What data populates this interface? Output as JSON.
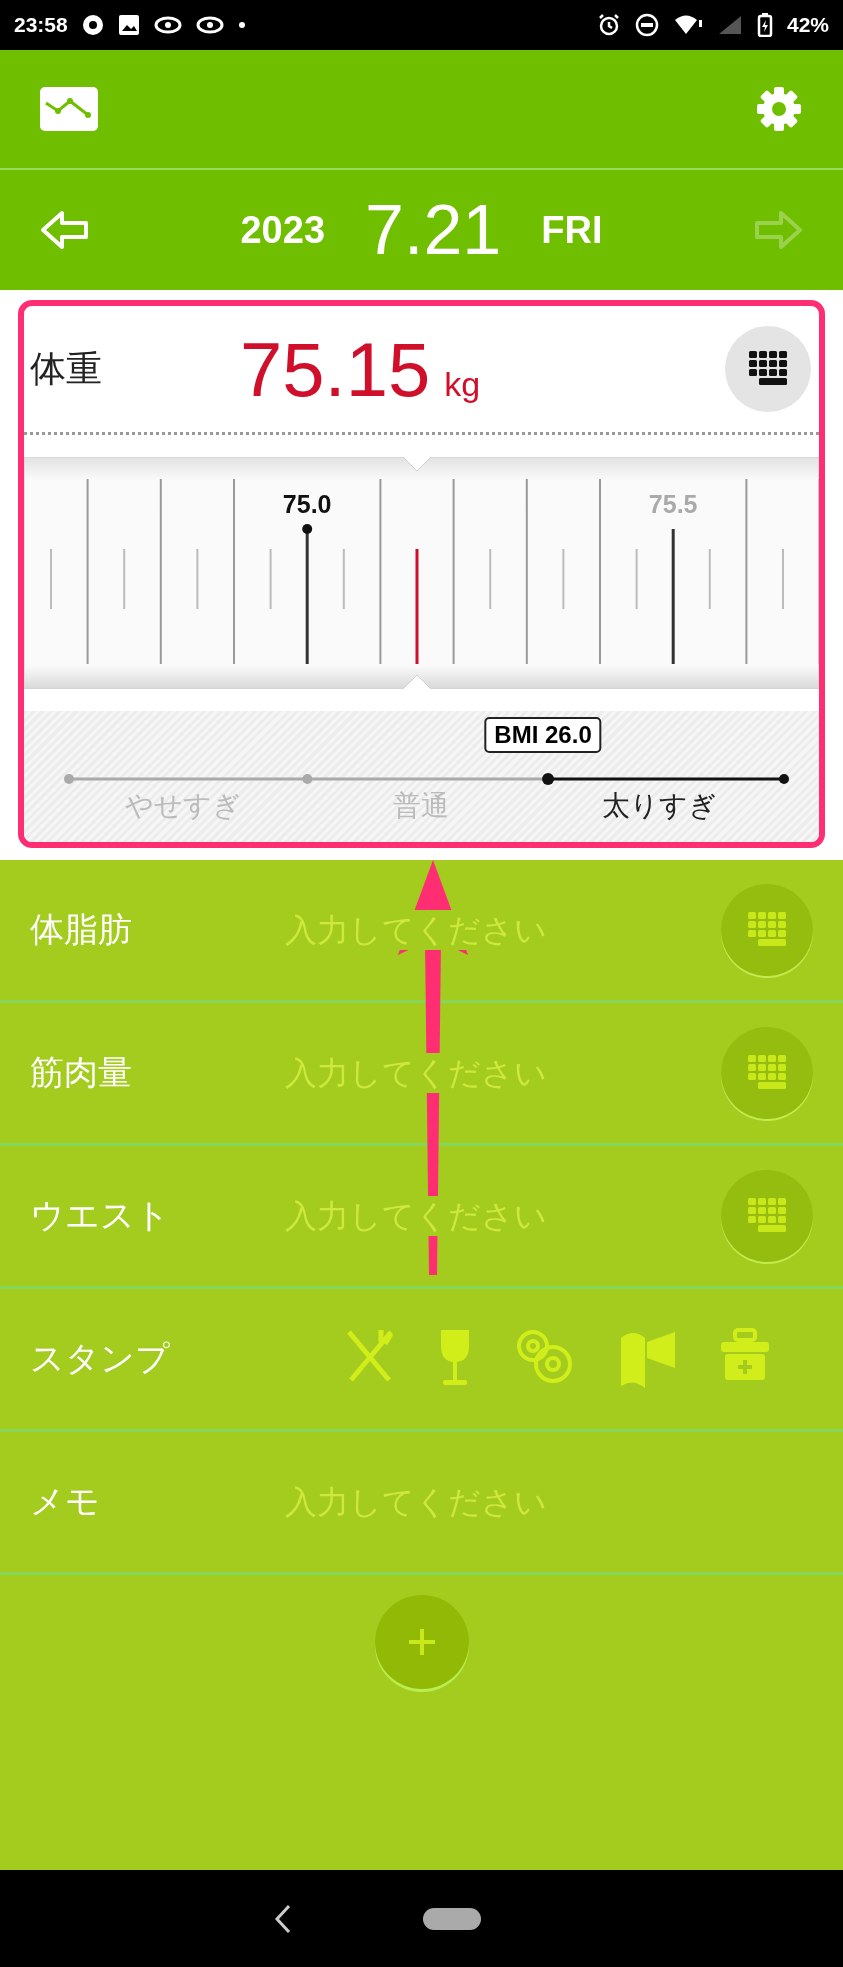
{
  "status_bar": {
    "time": "23:58",
    "battery": "42%"
  },
  "date_bar": {
    "year": "2023",
    "day": "7.21",
    "weekday": "FRI",
    "prev": {
      "disabled": false
    },
    "next": {
      "disabled": true
    }
  },
  "weight": {
    "label": "体重",
    "value": "75.15",
    "unit": "kg",
    "ruler_labels": [
      {
        "text": "75.0",
        "active": true
      },
      {
        "text": "75.5",
        "active": false
      }
    ],
    "bmi": {
      "label": "BMI 26.0",
      "level": 0.67,
      "categories": [
        {
          "label": "やせすぎ",
          "selected": false
        },
        {
          "label": "普通",
          "selected": false
        },
        {
          "label": "太りすぎ",
          "selected": true
        }
      ]
    }
  },
  "rows": [
    {
      "kind": "numeric",
      "label": "体脂肪",
      "placeholder": "入力してください"
    },
    {
      "kind": "numeric",
      "label": "筋肉量",
      "placeholder": "入力してください"
    },
    {
      "kind": "numeric",
      "label": "ウエスト",
      "placeholder": "入力してください"
    },
    {
      "kind": "stamps",
      "label": "スタンプ"
    },
    {
      "kind": "text",
      "label": "メモ",
      "placeholder": "入力してください"
    }
  ]
}
